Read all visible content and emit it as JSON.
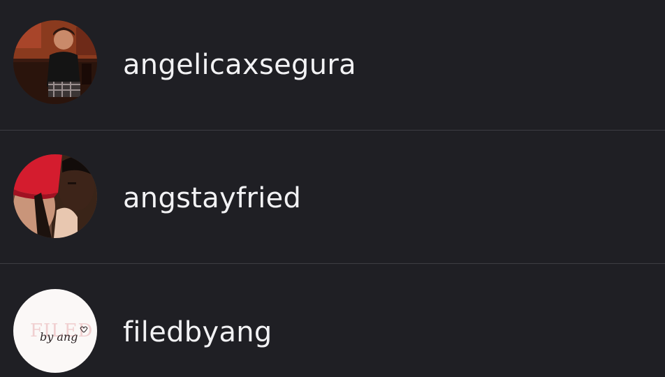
{
  "accounts": [
    {
      "username": "angelicaxsegura",
      "avatar": "photo-child-portrait"
    },
    {
      "username": "angstayfried",
      "avatar": "photo-selfie-red-hat"
    },
    {
      "username": "filedbyang",
      "avatar": "logo-filed-by-ang",
      "logo_text": "FILED",
      "logo_script": "by ang"
    }
  ],
  "colors": {
    "background": "#1f1f24",
    "divider": "#3d3d43",
    "text": "#f2f2f4"
  }
}
